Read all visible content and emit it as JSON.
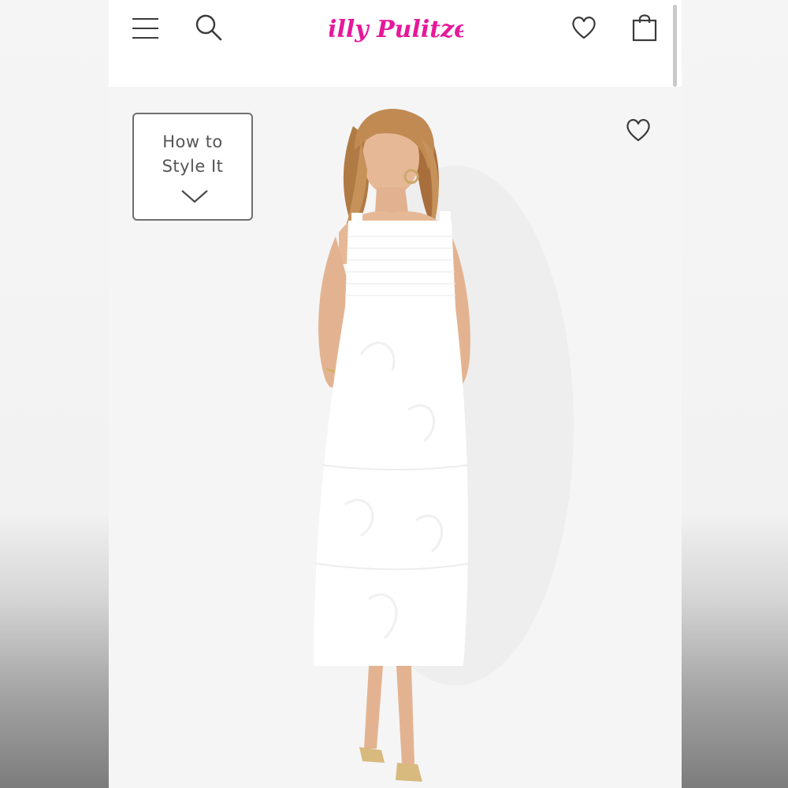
{
  "header": {
    "brand_logo": "Lilly Pulitzer",
    "brand_color": "#e5199a",
    "icons": {
      "menu": "hamburger-menu-icon",
      "search": "search-icon",
      "wishlist": "heart-icon",
      "bag": "shopping-bag-icon"
    }
  },
  "product": {
    "style_it_label_line1": "How to",
    "style_it_label_line2": "Style It",
    "style_it_icon": "chevron-down-icon",
    "wishlist_icon": "heart-outline-icon",
    "image_subject": "white smocked midi dress"
  },
  "colors": {
    "icon": "#3a3a3a",
    "dress": "#ffffff",
    "hair": "#b07a45",
    "skin": "#e6b896"
  }
}
